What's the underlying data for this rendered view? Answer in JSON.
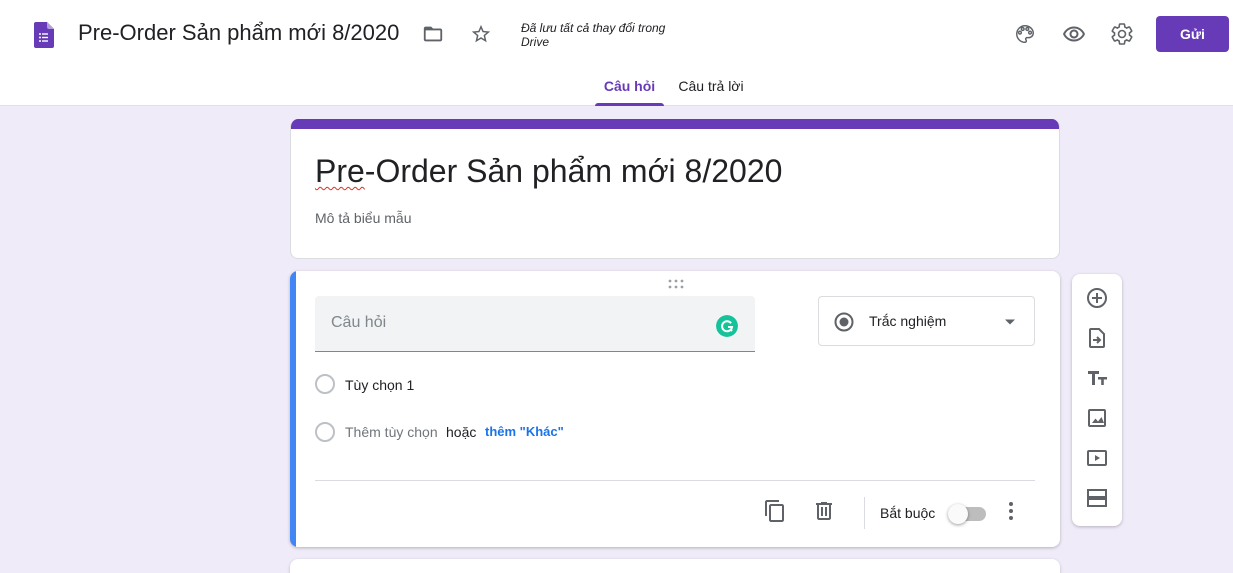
{
  "header": {
    "doc_title": "Pre-Order Sản phẩm mới 8/2020",
    "saved_status": "Đã lưu tất cả thay đổi trong Drive",
    "send_label": "Gửi",
    "icons": [
      "forms-logo-icon",
      "folder-icon",
      "star-icon",
      "palette-icon",
      "eye-icon",
      "gear-icon"
    ]
  },
  "tabs": [
    {
      "label": "Câu hỏi",
      "active": true
    },
    {
      "label": "Câu trả lời",
      "active": false
    }
  ],
  "form": {
    "title_part1": "Pre",
    "title_part2": "-Order Sản phẩm mới 8/2020",
    "description_placeholder": "Mô tả biểu mẫu"
  },
  "question": {
    "placeholder": "Câu hỏi",
    "type_label": "Trắc nghiệm",
    "option1": "Tùy chọn 1",
    "add_option": "Thêm tùy chọn",
    "or_text": "hoặc",
    "add_other": "thêm \"Khác\"",
    "required_label": "Bắt buộc",
    "required": false
  },
  "side_toolbar": [
    "add-question-icon",
    "import-questions-icon",
    "add-title-icon",
    "add-image-icon",
    "add-video-icon",
    "add-section-icon"
  ],
  "colors": {
    "accent": "#673ab7",
    "background": "#f0ebf8",
    "question_bar": "#4285f4",
    "link": "#1a73e8"
  }
}
